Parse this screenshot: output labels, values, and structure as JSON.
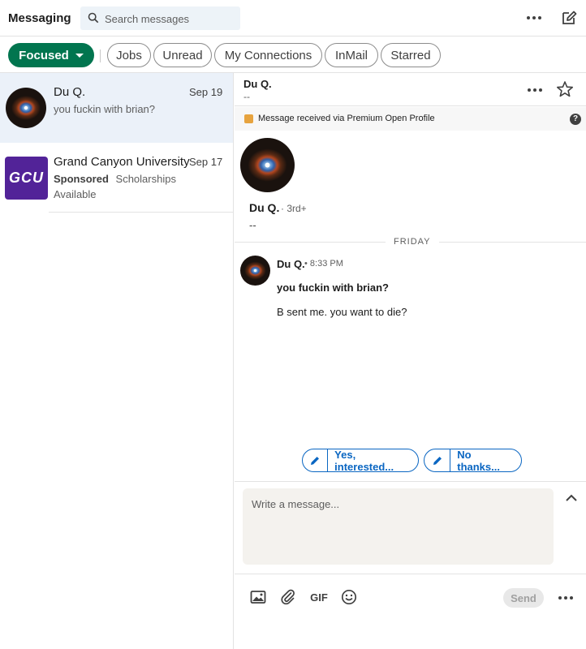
{
  "header": {
    "title": "Messaging",
    "search_placeholder": "Search messages"
  },
  "filters": {
    "focused": "Focused",
    "pills": [
      "Jobs",
      "Unread",
      "My Connections",
      "InMail",
      "Starred"
    ]
  },
  "conversations": [
    {
      "name": "Du Q.",
      "date": "Sep 19",
      "snippet": "you fuckin with brian?"
    },
    {
      "name": "Grand Canyon University",
      "date": "Sep 17",
      "sponsored": "Sponsored",
      "snippet": "Scholarships",
      "snippet2": "Available",
      "logo_text": "GCU",
      "logo_color": "#522398"
    }
  ],
  "thread": {
    "name": "Du Q.",
    "subtitle": "--",
    "banner": "Message received via Premium Open Profile",
    "profile_name": "Du Q.",
    "profile_degree": "· 3rd+",
    "profile_headline": "--",
    "day_label": "FRIDAY",
    "message": {
      "sender": "Du Q.",
      "time": "• 8:33 PM",
      "line1": "you fuckin with brian?",
      "line2": "B sent me. you want to die?"
    },
    "quick_replies": [
      "Yes, interested...",
      "No thanks..."
    ]
  },
  "composer": {
    "placeholder": "Write a message...",
    "gif_label": "GIF",
    "send_label": "Send"
  },
  "colors": {
    "focused_pill": "#01754f",
    "link_blue": "#0a66c2",
    "active_row": "#ebf1f9",
    "gcu_purple": "#522398"
  }
}
